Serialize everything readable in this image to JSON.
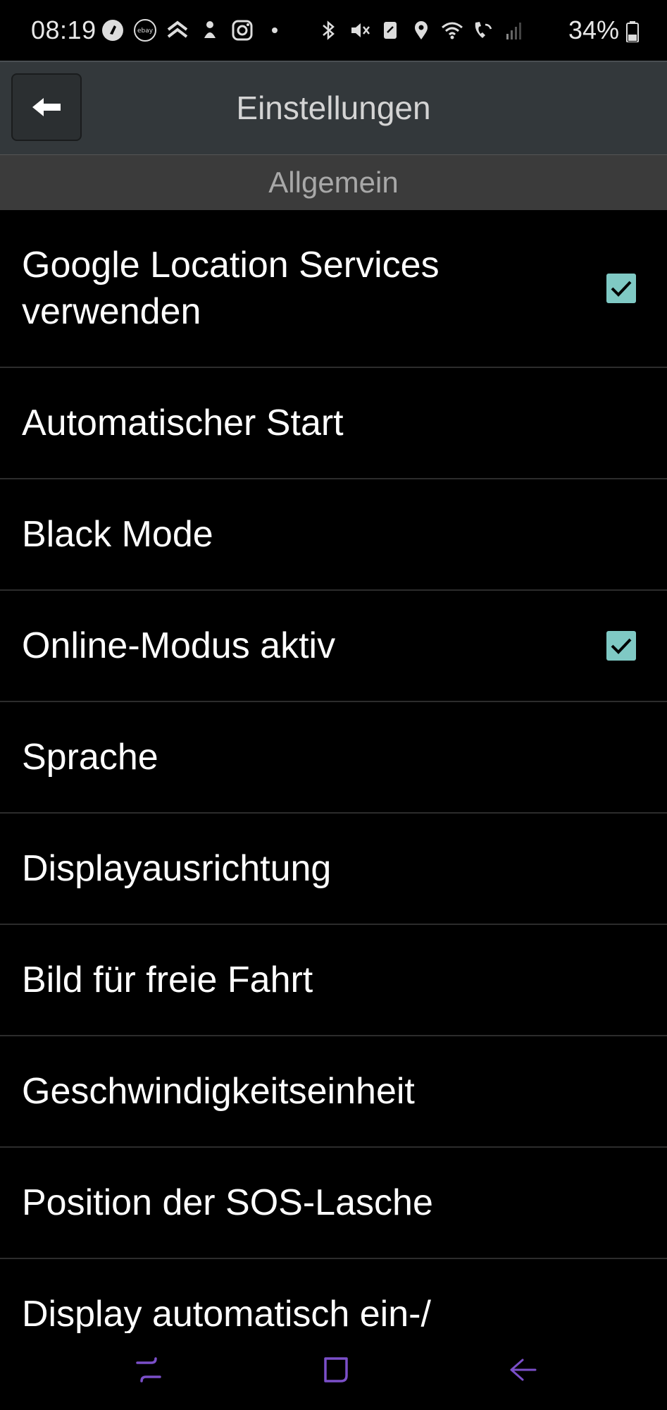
{
  "status_bar": {
    "time": "08:19",
    "battery_percent": "34%",
    "left_icons": [
      "music-app-icon",
      "ebay-kleinanzeigen-icon",
      "chevron-up-app-icon",
      "person-app-icon",
      "instagram-icon",
      "dot-icon"
    ],
    "right_icons": [
      "bluetooth-icon",
      "mute-icon",
      "nfc-icon",
      "location-icon",
      "wifi-icon",
      "wifi-call-icon",
      "signal-icon"
    ]
  },
  "app_bar": {
    "title": "Einstellungen",
    "back_icon": "arrow-left-icon"
  },
  "section": {
    "title": "Allgemein"
  },
  "settings": [
    {
      "label": "Google Location Services verwenden",
      "checked": true
    },
    {
      "label": "Automatischer Start",
      "checked": false
    },
    {
      "label": "Black Mode",
      "checked": false
    },
    {
      "label": "Online-Modus aktiv",
      "checked": true
    },
    {
      "label": "Sprache",
      "checked": false
    },
    {
      "label": "Displayausrichtung",
      "checked": false
    },
    {
      "label": "Bild für freie Fahrt",
      "checked": false
    },
    {
      "label": "Geschwindigkeitseinheit",
      "checked": false
    },
    {
      "label": "Position der SOS-Lasche",
      "checked": false
    },
    {
      "label": "Display automatisch ein-/",
      "checked": false
    }
  ],
  "colors": {
    "accent_checkbox": "#7fc9c4",
    "app_bar_bg": "#33383b",
    "section_bg": "#3b3b3b",
    "nav_icon": "#7b4fc9"
  },
  "nav_bar": {
    "icons": [
      "recent-apps-icon",
      "home-icon",
      "back-icon"
    ]
  }
}
